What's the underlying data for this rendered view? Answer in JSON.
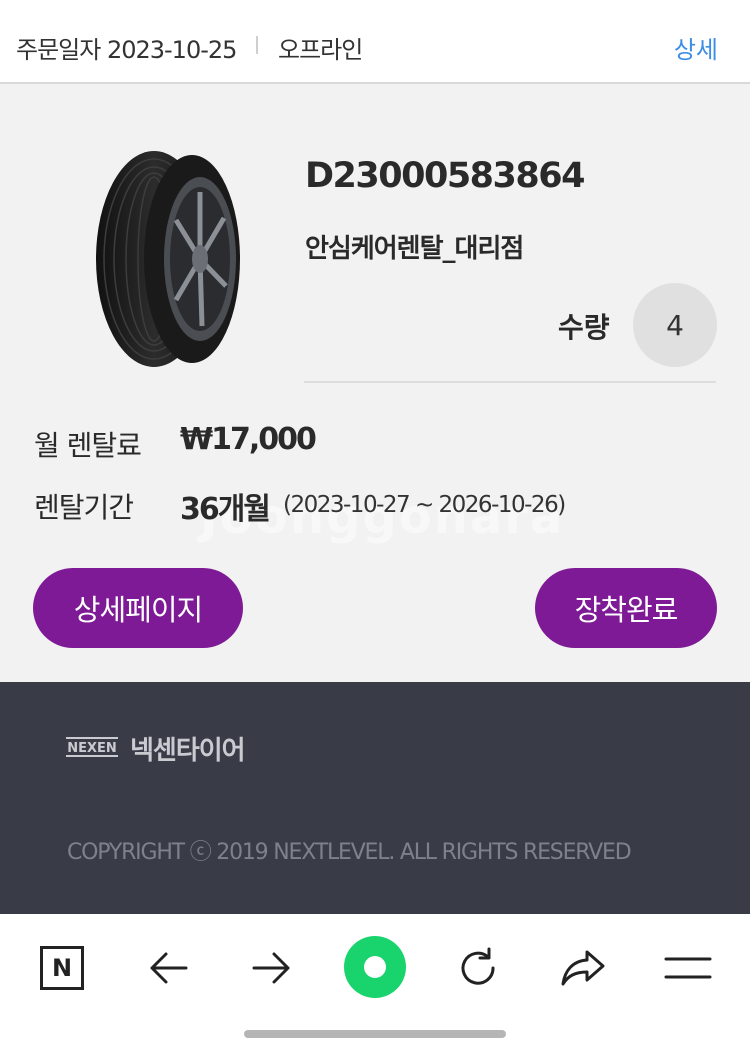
{
  "order": {
    "date": "주문일자 2023-10-25",
    "channel": "오프라인",
    "detail_link": "상세"
  },
  "product": {
    "order_no": "D23000583864",
    "store": "안심케어렌탈_대리점",
    "qty_label": "수량",
    "qty_value": "4"
  },
  "rental": {
    "fee_label": "월 렌탈료",
    "fee_value": "₩17,000",
    "period_label": "렌탈기간",
    "period_months": "36개월",
    "period_range": "(2023-10-27 ~ 2026-10-26)"
  },
  "watermark": "Joonggonara",
  "buttons": {
    "detail_page": "상세페이지",
    "install_done": "장착완료"
  },
  "footer": {
    "logo_text": "NEXEN",
    "brand": "넥센타이어",
    "copyright": "COPYRIGHT ⓒ 2019 NEXTLEVEL. ALL RIGHTS RESERVED"
  },
  "navbar": {
    "items": [
      "n-icon",
      "back-arrow-icon",
      "forward-arrow-icon",
      "home-dot-icon",
      "refresh-icon",
      "share-icon",
      "menu-icon"
    ],
    "n_letter": "N"
  },
  "colors": {
    "accent_purple": "#7e1a95",
    "link_blue": "#3a8ee6",
    "footer_bg": "#393c47",
    "home_green": "#19d46c"
  }
}
